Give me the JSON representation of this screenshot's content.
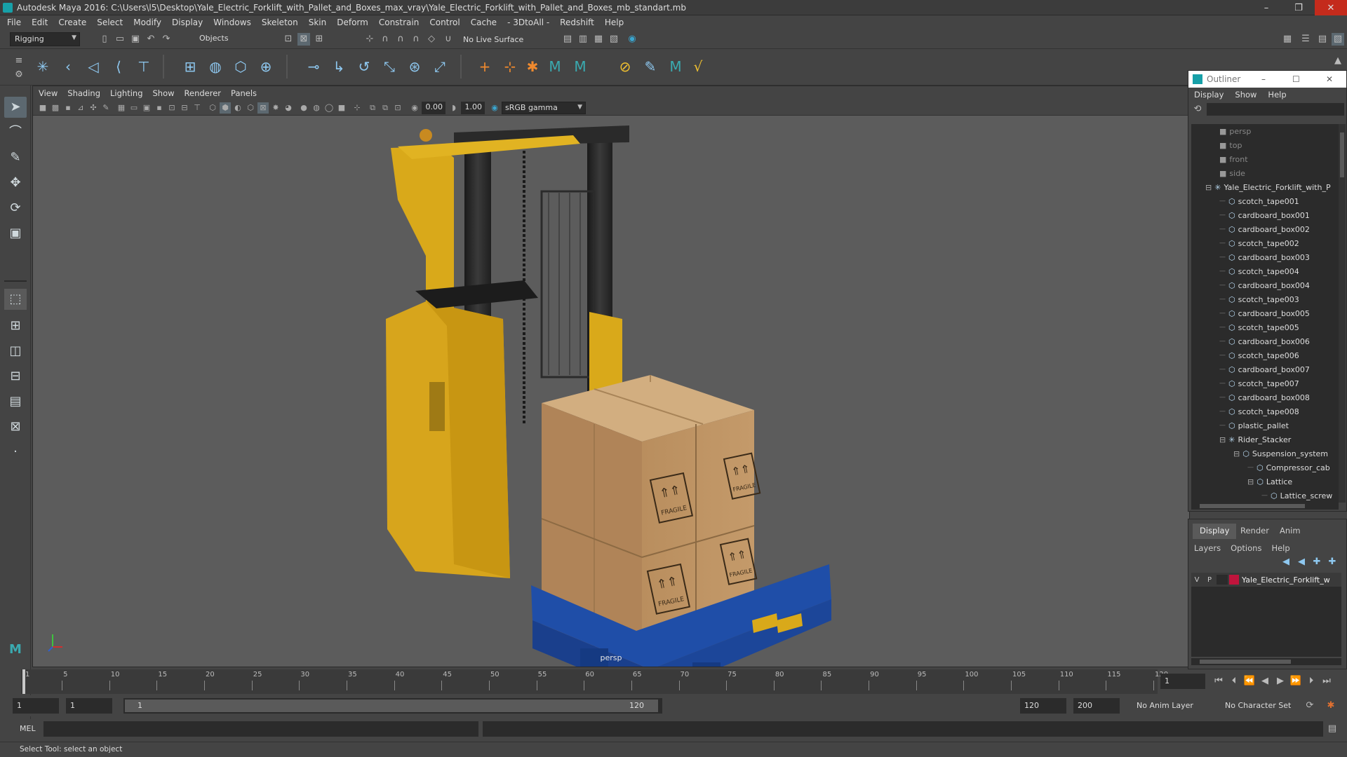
{
  "window": {
    "title": "Autodesk Maya 2016: C:\\Users\\l5\\Desktop\\Yale_Electric_Forklift_with_Pallet_and_Boxes_max_vray\\Yale_Electric_Forklift_with_Pallet_and_Boxes_mb_standart.mb",
    "minimize": "–",
    "maximize": "❐",
    "close": "✕"
  },
  "menubar": [
    "File",
    "Edit",
    "Create",
    "Select",
    "Modify",
    "Display",
    "Windows",
    "Skeleton",
    "Skin",
    "Deform",
    "Constrain",
    "Control",
    "Cache",
    "- 3DtoAll -",
    "Redshift",
    "Help"
  ],
  "statusline": {
    "mode": "Rigging",
    "selection_mask": "Objects",
    "live_surface": "No Live Surface"
  },
  "viewport": {
    "menu": [
      "View",
      "Shading",
      "Lighting",
      "Show",
      "Renderer",
      "Panels"
    ],
    "exposure": "0.00",
    "gamma": "1.00",
    "color_space": "sRGB gamma",
    "camera_label": "persp"
  },
  "outliner": {
    "title": "Outliner",
    "menu": [
      "Display",
      "Show",
      "Help"
    ],
    "items": [
      {
        "label": "persp",
        "type": "camera",
        "depth": 0
      },
      {
        "label": "top",
        "type": "camera",
        "depth": 0
      },
      {
        "label": "front",
        "type": "camera",
        "depth": 0
      },
      {
        "label": "side",
        "type": "camera",
        "depth": 0
      },
      {
        "label": "Yale_Electric_Forklift_with_P",
        "type": "group",
        "depth": 0
      },
      {
        "label": "scotch_tape001",
        "type": "mesh",
        "depth": 1
      },
      {
        "label": "cardboard_box001",
        "type": "mesh",
        "depth": 1
      },
      {
        "label": "cardboard_box002",
        "type": "mesh",
        "depth": 1
      },
      {
        "label": "scotch_tape002",
        "type": "mesh",
        "depth": 1
      },
      {
        "label": "cardboard_box003",
        "type": "mesh",
        "depth": 1
      },
      {
        "label": "scotch_tape004",
        "type": "mesh",
        "depth": 1
      },
      {
        "label": "cardboard_box004",
        "type": "mesh",
        "depth": 1
      },
      {
        "label": "scotch_tape003",
        "type": "mesh",
        "depth": 1
      },
      {
        "label": "cardboard_box005",
        "type": "mesh",
        "depth": 1
      },
      {
        "label": "scotch_tape005",
        "type": "mesh",
        "depth": 1
      },
      {
        "label": "cardboard_box006",
        "type": "mesh",
        "depth": 1
      },
      {
        "label": "scotch_tape006",
        "type": "mesh",
        "depth": 1
      },
      {
        "label": "cardboard_box007",
        "type": "mesh",
        "depth": 1
      },
      {
        "label": "scotch_tape007",
        "type": "mesh",
        "depth": 1
      },
      {
        "label": "cardboard_box008",
        "type": "mesh",
        "depth": 1
      },
      {
        "label": "scotch_tape008",
        "type": "mesh",
        "depth": 1
      },
      {
        "label": "plastic_pallet",
        "type": "mesh",
        "depth": 1
      },
      {
        "label": "Rider_Stacker",
        "type": "group",
        "depth": 1
      },
      {
        "label": "Suspension_system",
        "type": "mesh",
        "depth": 2
      },
      {
        "label": "Compressor_cab",
        "type": "mesh",
        "depth": 3
      },
      {
        "label": "Lattice",
        "type": "mesh",
        "depth": 3
      },
      {
        "label": "Lattice_screw",
        "type": "mesh",
        "depth": 4
      }
    ]
  },
  "layers": {
    "tabs": [
      "Display",
      "Render",
      "Anim"
    ],
    "menu": [
      "Layers",
      "Options",
      "Help"
    ],
    "layer": {
      "v": "V",
      "p": "P",
      "name": "Yale_Electric_Forklift_w",
      "color": "#c0143c"
    }
  },
  "timeline": {
    "ticks": [
      "1",
      "5",
      "10",
      "15",
      "20",
      "25",
      "30",
      "35",
      "40",
      "45",
      "50",
      "55",
      "60",
      "65",
      "70",
      "75",
      "80",
      "85",
      "90",
      "95",
      "100",
      "105",
      "110",
      "115",
      "120"
    ],
    "current_frame": "1"
  },
  "range": {
    "start": "1",
    "playback_start": "1",
    "slider_start": "1",
    "slider_end": "120",
    "playback_end": "120",
    "end": "200",
    "anim_layer": "No Anim Layer",
    "character_set": "No Character Set"
  },
  "cmdline": {
    "label": "MEL"
  },
  "helpline": {
    "text": "Select Tool: select an object"
  },
  "fragile_label": "FRAGILE"
}
